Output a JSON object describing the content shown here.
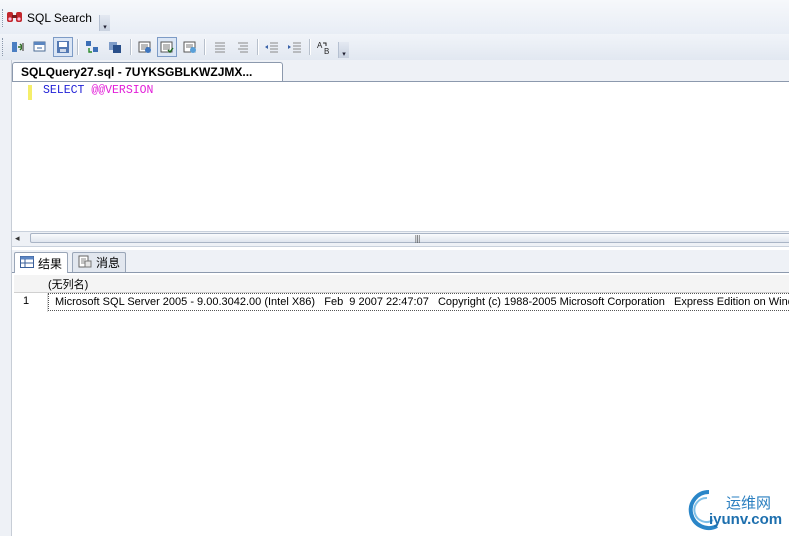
{
  "toolbar_top": {
    "sqlsearch_label": "SQL Search"
  },
  "toolbar_secondary": {
    "buttons": [
      "connect-icon",
      "disconnect-icon",
      "save-results-icon",
      "results-to-text-icon",
      "results-to-grid-icon",
      "display-plan-icon",
      "include-plan-icon",
      "client-stats-icon",
      "comment-icon",
      "uncomment-icon",
      "decrease-indent-icon",
      "increase-indent-icon",
      "specify-values-icon"
    ]
  },
  "editor": {
    "tab_title": "SQLQuery27.sql - 7UYKSGBLKWZJMX...",
    "code_keyword": "SELECT",
    "code_function": "@@VERSION"
  },
  "results": {
    "tabs": [
      {
        "label": "结果",
        "icon": "grid-icon"
      },
      {
        "label": "消息",
        "icon": "messages-icon"
      }
    ],
    "column_header": "(无列名)",
    "rows": [
      {
        "num": "1",
        "value": "Microsoft SQL Server 2005 - 9.00.3042.00 (Intel X86)   Feb  9 2007 22:47:07   Copyright (c) 1988-2005 Microsoft Corporation   Express Edition on Windows NT"
      }
    ]
  },
  "watermark": {
    "name": "运维网",
    "url": "iyunv.com"
  },
  "colors": {
    "keyword": "#1f1fd6",
    "function": "#e21ed9",
    "change_marker": "#f5ee6a"
  }
}
